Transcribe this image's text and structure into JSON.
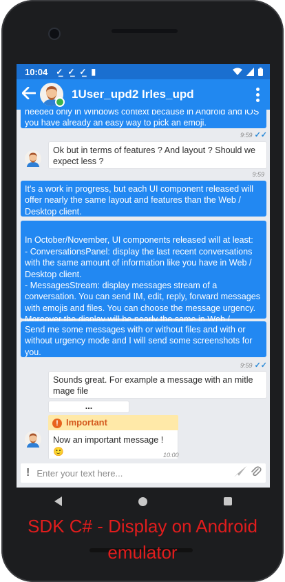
{
  "status_bar": {
    "time": "10:04"
  },
  "header": {
    "title": "1User_upd2 Irles_upd"
  },
  "messages": [
    {
      "text": "needed only in Windows context because in Android and iOS you have already an easy way to pick an emoji.",
      "time": "9:59"
    },
    {
      "text": "Ok but in terms of features ? And layout ? Should we expect less ?",
      "time": "9:59"
    },
    {
      "text": "It's a work in progress, but each UI component released will offer nearly the same layout and features than the Web / Desktop client."
    },
    {
      "text": "In October/November, UI components released will at least:\n- ConversationsPanel: display the last recent conversations with the same amount of information like you have in Web / Desktop client.\n- MessagesStream: display messages stream of a conversation. You can send IM, edit, reply, forward messages with emojis and files. You can choose the message urgency. Moreover the display will be nearly the same in Web / Desktop client."
    },
    {
      "text": "Send me some messages with or without files and with or without urgency mode and I will send some screenshots for you.",
      "time": "9:59"
    },
    {
      "text": "Sounds great. For example a message with an mitle mage file"
    },
    {
      "text": "..."
    },
    {
      "label": "Important",
      "text": "Now an important message ! 🙂",
      "time": "10:00"
    }
  ],
  "input": {
    "placeholder": "Enter your text here..."
  },
  "overlay_caption": {
    "line1": "SDK C# - Display on Android",
    "line2": "emulator"
  },
  "colors": {
    "header": "#2188f0",
    "status_bar": "#1a6fd0",
    "outgoing_bubble": "#2288f2",
    "important": "#e8641e",
    "caption": "#e11d1d"
  }
}
